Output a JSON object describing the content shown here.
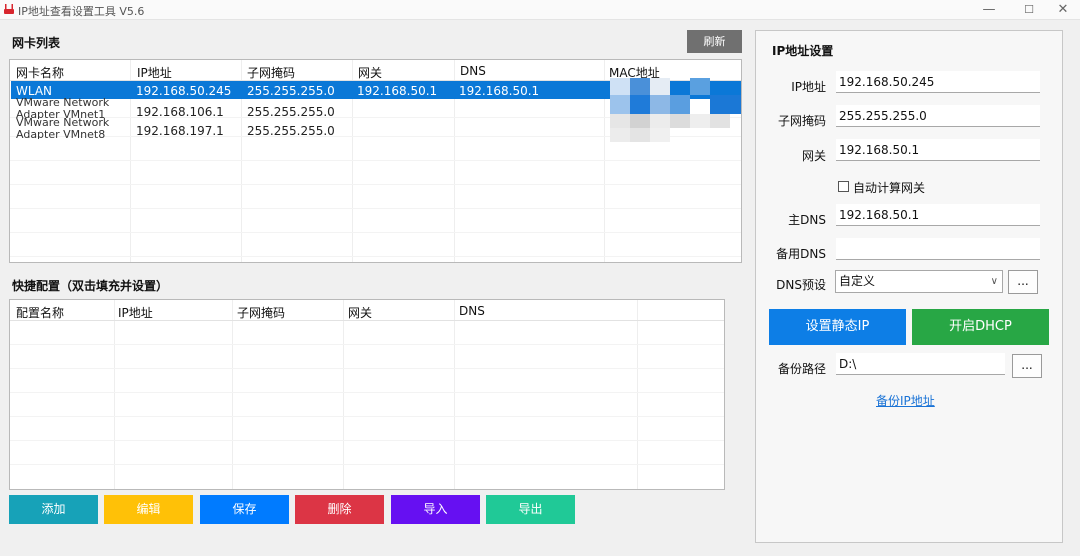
{
  "window": {
    "title": "IP地址查看设置工具 V5.6",
    "min_glyph": "—",
    "max_glyph": "☐",
    "close_glyph": "✕"
  },
  "adapters": {
    "title": "网卡列表",
    "refresh_label": "刷新",
    "columns": [
      "网卡名称",
      "IP地址",
      "子网掩码",
      "网关",
      "DNS",
      "MAC地址"
    ],
    "rows": [
      {
        "name": "WLAN",
        "ip": "192.168.50.245",
        "mask": "255.255.255.0",
        "gateway": "192.168.50.1",
        "dns": "192.168.50.1"
      },
      {
        "name": "VMware Network Adapter VMnet1",
        "name_line1": "VMware Network",
        "name_line2": "Adapter VMnet1",
        "ip": "192.168.106.1",
        "mask": "255.255.255.0",
        "gateway": "",
        "dns": ""
      },
      {
        "name": "VMware Network Adapter VMnet8",
        "name_line1": "VMware Network",
        "name_line2": "Adapter VMnet8",
        "ip": "192.168.197.1",
        "mask": "255.255.255.0",
        "gateway": "",
        "dns": ""
      }
    ]
  },
  "quick_config": {
    "title": "快捷配置（双击填充并设置）",
    "columns": [
      "配置名称",
      "IP地址",
      "子网掩码",
      "网关",
      "DNS"
    ]
  },
  "actions": {
    "add": "添加",
    "edit": "编辑",
    "save": "保存",
    "delete": "删除",
    "import": "导入",
    "export": "导出"
  },
  "ip_settings": {
    "title": "IP地址设置",
    "ip_label": "IP地址",
    "ip_value": "192.168.50.245",
    "mask_label": "子网掩码",
    "mask_value": "255.255.255.0",
    "gateway_label": "网关",
    "gateway_value": "192.168.50.1",
    "auto_gateway_label": "自动计算网关",
    "auto_gateway_checked": false,
    "dns1_label": "主DNS",
    "dns1_value": "192.168.50.1",
    "dns2_label": "备用DNS",
    "dns2_value": "",
    "dns_preset_label": "DNS预设",
    "dns_preset_value": "自定义",
    "more_label": "...",
    "set_static_label": "设置静态IP",
    "dhcp_label": "开启DHCP",
    "backup_path_label": "备份路径",
    "backup_path_value": "D:\\",
    "backup_link": "备份IP地址"
  },
  "colors": {
    "selection": "#0b78d7",
    "add": "#17a2b8",
    "edit": "#ffc107",
    "save": "#007bff",
    "delete": "#dc3545",
    "import": "#6610f2",
    "export": "#20c997",
    "static_ip": "#0d7ee6",
    "dhcp": "#28a745"
  }
}
